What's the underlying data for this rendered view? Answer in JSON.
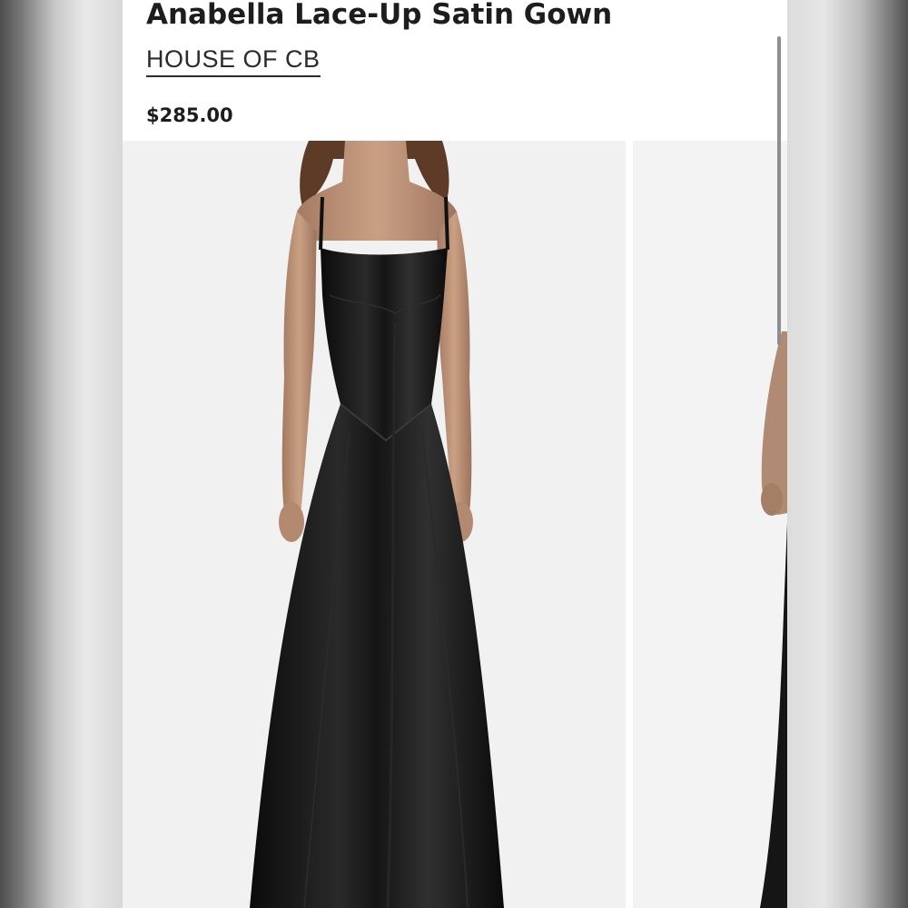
{
  "product": {
    "title": "Anabella Lace-Up Satin Gown",
    "brand": "HOUSE OF CB",
    "price": "$285.00"
  },
  "gallery": {
    "images": [
      {
        "alt": "Model wearing black satin gown, front view"
      },
      {
        "alt": "Model wearing black satin gown, partial view"
      }
    ]
  },
  "colors": {
    "background": "#ffffff",
    "text": "#1d1d1d",
    "photo_background": "#f1f1f1",
    "gown": "#141414"
  }
}
